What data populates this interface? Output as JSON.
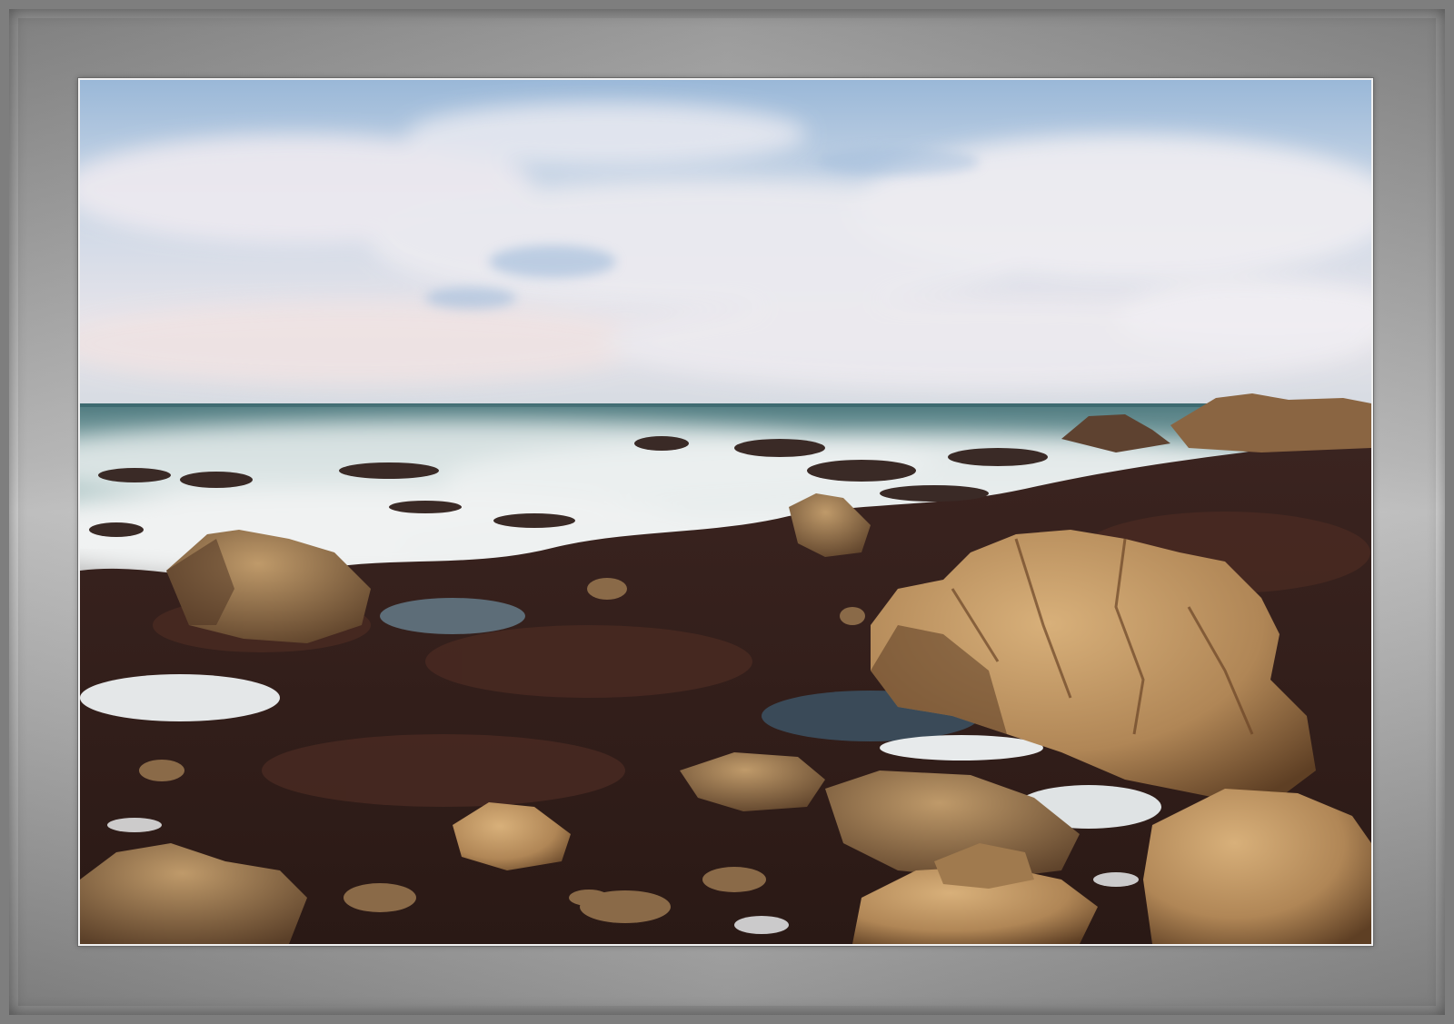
{
  "image": {
    "subject": "",
    "colors": {
      "mat_light": "#d3d3d3",
      "mat_dark": "#7e7e7e",
      "sky_top": "#8fb0d3",
      "cloud": "#e9e8ec",
      "ocean": "#5f8a8a",
      "foam": "#e8ecec",
      "seaweed": "#3a1f1a",
      "rock_light": "#c49a62",
      "rock_shadow": "#6e4a2a"
    }
  }
}
